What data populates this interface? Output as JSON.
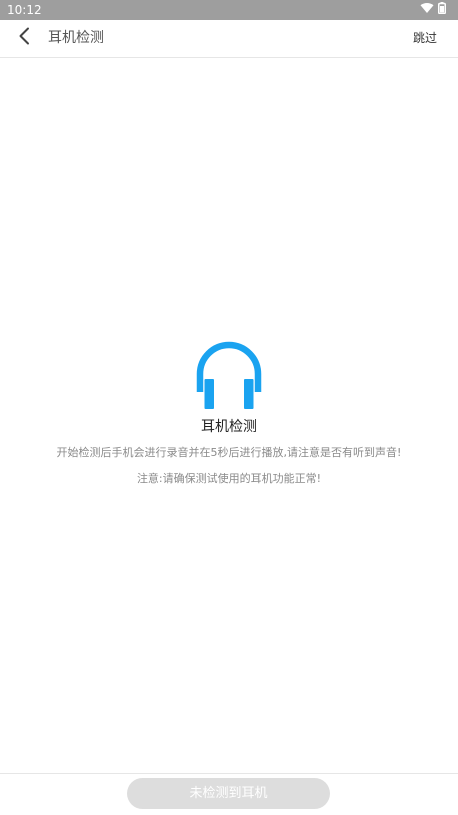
{
  "status_bar": {
    "time": "10:12",
    "icons": [
      "wifi-icon",
      "battery-icon"
    ]
  },
  "app_bar": {
    "title": "耳机检测",
    "skip_label": "跳过",
    "back_icon": "chevron-left-icon"
  },
  "content": {
    "icon": "headphone-icon",
    "icon_color": "#1aa3f0",
    "title": "耳机检测",
    "description_1": "开始检测后手机会进行录音并在5秒后进行播放,请注意是否有听到声音!",
    "description_2": "注意:请确保测试使用的耳机功能正常!"
  },
  "bottom": {
    "button_label": "未检测到耳机",
    "button_enabled": false
  }
}
